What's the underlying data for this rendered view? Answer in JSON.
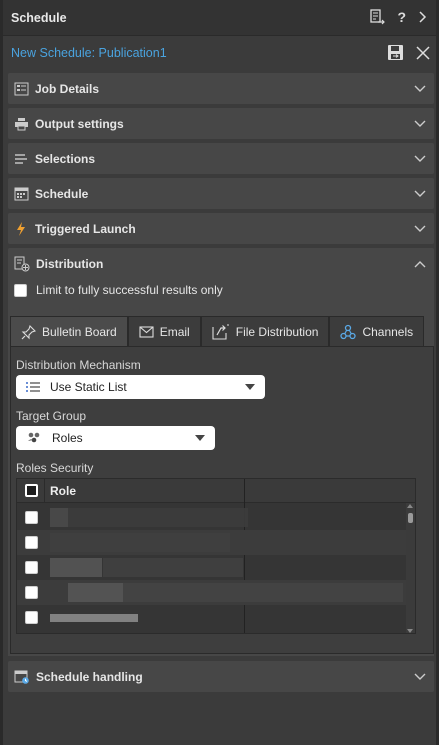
{
  "window": {
    "title": "Schedule"
  },
  "document": {
    "title": "New Schedule: Publication1"
  },
  "sections": {
    "job_details": "Job Details",
    "output_settings": "Output settings",
    "selections": "Selections",
    "schedule": "Schedule",
    "triggered_launch": "Triggered Launch",
    "distribution": "Distribution",
    "schedule_handling": "Schedule handling"
  },
  "distribution": {
    "limit_label": "Limit to fully successful results only",
    "tabs": [
      "Bulletin Board",
      "Email",
      "File Distribution",
      "Channels"
    ],
    "active_tab": "Bulletin Board",
    "mechanism_label": "Distribution Mechanism",
    "mechanism_value": "Use Static List",
    "target_group_label": "Target Group",
    "target_group_value": "Roles",
    "roles_security_label": "Roles Security",
    "roles_column": "Role"
  },
  "colors": {
    "accent": "#4aa3df",
    "panel_bg": "#3b3b3b",
    "section_bg": "#474747",
    "lightning": "#f0a030",
    "channels_icon": "#5aa9e6"
  },
  "icons": {
    "titlebar": [
      "list-export-icon",
      "help-icon",
      "chevron-right-icon"
    ],
    "subbar": [
      "save-icon",
      "close-icon"
    ]
  }
}
